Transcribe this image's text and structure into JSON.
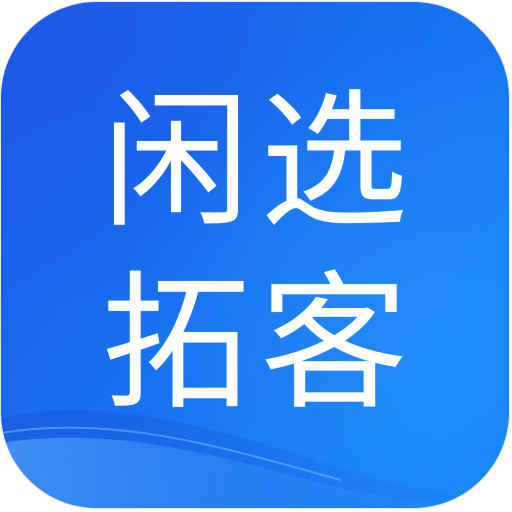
{
  "app_icon": {
    "line_1": "闲选",
    "line_2": "拓客",
    "colors": {
      "background_start": "#1f5bea",
      "background_end": "#1786f4",
      "text": "#ffffff"
    }
  }
}
